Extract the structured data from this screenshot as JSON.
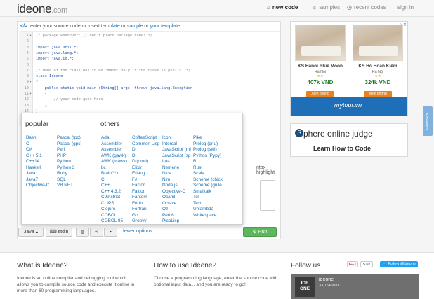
{
  "header": {
    "logo": "ideone",
    "logo_suffix": ".com",
    "nav": [
      {
        "icon": "home-icon",
        "label": "new code"
      },
      {
        "icon": "bulb-icon",
        "label": "samples"
      },
      {
        "icon": "clock-icon",
        "label": "recent codes"
      },
      {
        "icon": "",
        "label": "sign in"
      }
    ]
  },
  "editor": {
    "hint_prefix": "enter your source code or insert",
    "hint_link_template": "template",
    "hint_or": "or",
    "hint_link_sample": "sample",
    "hint_or2": "or",
    "hint_link_yours": "your template",
    "lines": [
      {
        "n": "1",
        "fold": "▾",
        "text": "/* package whatever; // don't place package name! */"
      },
      {
        "n": "2",
        "fold": "",
        "text": ""
      },
      {
        "n": "3",
        "fold": "",
        "text": "import java.util.*;"
      },
      {
        "n": "4",
        "fold": "",
        "text": "import java.lang.*;"
      },
      {
        "n": "5",
        "fold": "",
        "text": "import java.io.*;"
      },
      {
        "n": "6",
        "fold": "",
        "text": ""
      },
      {
        "n": "7",
        "fold": "",
        "text": "/* Name of the class has to be \"Main\" only if the class is public. */"
      },
      {
        "n": "8",
        "fold": "",
        "text": "class Ideone"
      },
      {
        "n": "9",
        "fold": "▾",
        "text": "{"
      },
      {
        "n": "10",
        "fold": "",
        "text": "    public static void main (String[] args) throws java.lang.Exception"
      },
      {
        "n": "11",
        "fold": "▾",
        "text": "    {"
      },
      {
        "n": "12",
        "fold": "",
        "text": "        // your code goes here"
      },
      {
        "n": "13",
        "fold": "",
        "text": "    }"
      },
      {
        "n": "14",
        "fold": "",
        "text": "}"
      }
    ],
    "syntax_label": "ntax highlight"
  },
  "toolbar": {
    "language": "Java",
    "stdin": "stdin",
    "fewer_options": "fewer options",
    "run": "Run"
  },
  "languages": {
    "popular_title": "popular",
    "others_title": "others",
    "popular_col1": [
      "Bash",
      "C",
      "C#",
      "C++ 5.1",
      "C++14",
      "Haskell",
      "Java",
      "Java7",
      "Objective-C"
    ],
    "popular_col2": [
      "Pascal (fpc)",
      "Pascal (gpc)",
      "Perl",
      "PHP",
      "Python",
      "Python 3",
      "Ruby",
      "SQL",
      "VB.NET"
    ],
    "others_col1": [
      "Ada",
      "Assembler",
      "Assembler",
      "AWK (gawk)",
      "AWK (mawk)",
      "bc",
      "Brainf**k",
      "C",
      "C++",
      "C++ 4.3.2",
      "C99 strict",
      "CLIPS",
      "Clojure",
      "COBOL",
      "COBOL 85"
    ],
    "others_col2": [
      "CoffeeScript",
      "Common Lisp",
      "D",
      "D",
      "D (dmd)",
      "Elixir",
      "Erlang",
      "F#",
      "Factor",
      "Falcon",
      "Fantom",
      "Forth",
      "Fortran",
      "Go",
      "Groovy"
    ],
    "others_col3": [
      "Icon",
      "Intercal",
      "JavaScript (rhi",
      "JavaScript (sp",
      "Lua",
      "Nemerle",
      "Nice",
      "Nim",
      "Node.js",
      "Objective-C",
      "Ocaml",
      "Octave",
      "Oz",
      "Perl 6",
      "PicoLisp"
    ],
    "others_col4": [
      "Pike",
      "Prolog (gnu)",
      "Prolog (swi)",
      "Python (Pypy)",
      "R",
      "Rust",
      "Scala",
      "Scheme (chick",
      "Scheme (guile",
      "Smalltalk",
      "Tcl",
      "Text",
      "Unlambda",
      "Whitespace"
    ]
  },
  "ads": {
    "hotels": [
      {
        "name": "KS Hanoi Blue Moon",
        "city": "Hà Nội",
        "stars": "★★",
        "price": "407k VND",
        "button": "Xem phòng"
      },
      {
        "name": "KS Hồ Hoàn Kiếm",
        "city": "Hà Nội",
        "stars": "★★",
        "price": "324k VND",
        "button": "Xem phòng"
      }
    ],
    "hotel_brand": "mytour.vn",
    "spoj_title": "phere online judge",
    "spoj_logo": "S",
    "spoj_sub": "Learn How to Code",
    "feedback": "Feedback"
  },
  "footer": {
    "what_title": "What is Ideone?",
    "what_text": "Ideone is an online compiler and debugging tool which allows you to compile source code and execute it online in more than 60 programming languages.",
    "how_title": "How to use Ideone?",
    "how_text": "Choose a programming language, enter the source code with optional input data... and you are ready to go!",
    "follow_title": "Follow us",
    "gplus": "G+1",
    "gplus_count": "5.6k",
    "twitter": "Follow @ideone",
    "fb_logo_line1": "IDE",
    "fb_logo_line2": "ONE",
    "fb_name": "ideone",
    "fb_likes": "33,154 likes"
  },
  "colors": {
    "link": "#1a6fb0",
    "run": "#5cb85c",
    "twitter": "#1da1f2",
    "brand_strip": "#1e6fb8"
  }
}
